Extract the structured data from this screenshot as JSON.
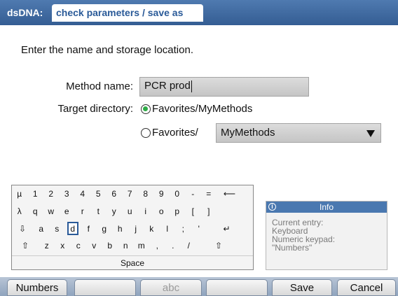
{
  "header": {
    "prefix": "dsDNA:",
    "tab": "check parameters / save as"
  },
  "instruction": "Enter the name and storage location.",
  "form": {
    "method_label": "Method name:",
    "method_value": "PCR prod",
    "target_label": "Target directory:",
    "option_1": "Favorites/MyMethods",
    "option_2": "Favorites/",
    "option_2_selected_value": "MyMethods",
    "selected_option": 1
  },
  "keyboard": {
    "rows": [
      [
        "µ",
        "1",
        "2",
        "3",
        "4",
        "5",
        "6",
        "7",
        "8",
        "9",
        "0",
        "-",
        "=",
        "⟵"
      ],
      [
        "λ",
        "q",
        "w",
        "e",
        "r",
        "t",
        "y",
        "u",
        "i",
        "o",
        "p",
        "[",
        "]"
      ],
      [
        "⇩",
        "a",
        "s",
        "d",
        "f",
        "g",
        "h",
        "j",
        "k",
        "l",
        ";",
        "'",
        "↵"
      ],
      [
        "⇧",
        "z",
        "x",
        "c",
        "v",
        "b",
        "n",
        "m",
        ",",
        ".",
        "/",
        "⇧"
      ]
    ],
    "selected_key": "d",
    "space_label": "Space"
  },
  "info": {
    "title": "Info",
    "icon": "info-icon",
    "lines": [
      "Current entry:",
      "Keyboard",
      "Numeric keypad:",
      "\"Numbers\""
    ]
  },
  "softkeys": [
    {
      "label": "Numbers",
      "enabled": true
    },
    {
      "label": "",
      "enabled": true
    },
    {
      "label": "abc",
      "enabled": false
    },
    {
      "label": "",
      "enabled": true
    },
    {
      "label": "Save",
      "enabled": true
    },
    {
      "label": "Cancel",
      "enabled": true
    }
  ],
  "colors": {
    "accent": "#2a5a98",
    "header": "#345d93",
    "radio_selected": "#2eab46"
  }
}
